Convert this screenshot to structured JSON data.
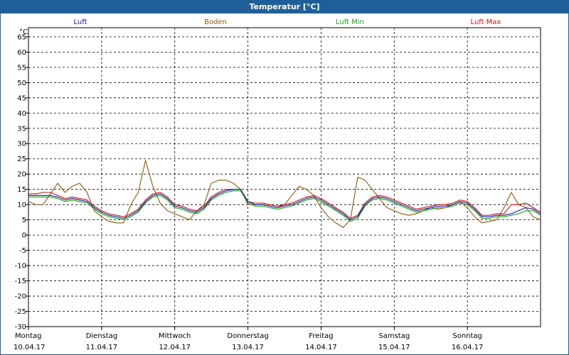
{
  "chart_data": {
    "type": "line",
    "title": "Temperatur [°C]",
    "ylabel": "°C",
    "ylim": [
      -30,
      68
    ],
    "yticks": [
      65,
      60,
      55,
      50,
      45,
      40,
      35,
      30,
      25,
      20,
      15,
      10,
      5,
      0,
      -5,
      -10,
      -15,
      -20,
      -25,
      -30
    ],
    "xlim": [
      0,
      7
    ],
    "grid": true,
    "legend_position": "top",
    "day_labels": [
      {
        "day": "Montag",
        "date": "10.04.17"
      },
      {
        "day": "Dienstag",
        "date": "11.04.17"
      },
      {
        "day": "Mittwoch",
        "date": "12.04.17"
      },
      {
        "day": "Donnerstag",
        "date": "13.04.17"
      },
      {
        "day": "Freitag",
        "date": "14.04.17"
      },
      {
        "day": "Samstag",
        "date": "15.04.17"
      },
      {
        "day": "Sonntag",
        "date": "16.04.17"
      }
    ],
    "series": [
      {
        "name": "Luft",
        "color": "#1a1aa6",
        "x": [
          0,
          0.1,
          0.2,
          0.3,
          0.4,
          0.5,
          0.6,
          0.7,
          0.8,
          0.9,
          1.0,
          1.1,
          1.2,
          1.3,
          1.4,
          1.5,
          1.6,
          1.7,
          1.8,
          1.9,
          2.0,
          2.1,
          2.2,
          2.3,
          2.4,
          2.5,
          2.6,
          2.7,
          2.8,
          2.9,
          3.0,
          3.1,
          3.2,
          3.3,
          3.4,
          3.5,
          3.6,
          3.7,
          3.8,
          3.9,
          4.0,
          4.1,
          4.2,
          4.3,
          4.4,
          4.5,
          4.6,
          4.7,
          4.8,
          4.9,
          5.0,
          5.1,
          5.2,
          5.3,
          5.4,
          5.5,
          5.6,
          5.7,
          5.8,
          5.9,
          6.0,
          6.1,
          6.2,
          6.3,
          6.4,
          6.5,
          6.6,
          6.7,
          6.8,
          6.9,
          7.0
        ],
        "y": [
          13,
          13,
          13,
          13,
          12.5,
          11.5,
          12,
          11.5,
          11,
          9,
          7.5,
          6.5,
          6,
          5.5,
          6.5,
          8,
          11,
          13,
          13.5,
          12,
          9.5,
          9,
          8,
          7.5,
          9,
          12,
          13.5,
          14.5,
          15,
          15,
          11,
          10,
          10,
          9.5,
          9,
          9.5,
          10,
          11,
          12,
          12.5,
          11.5,
          10,
          8.5,
          7,
          5,
          6,
          10,
          12,
          12.5,
          12,
          11,
          10,
          9,
          8,
          8.5,
          9,
          9.5,
          9.5,
          10,
          11,
          10.5,
          8.5,
          6,
          6,
          6.5,
          6.5,
          7,
          8,
          9,
          8.5,
          7
        ]
      },
      {
        "name": "Boden",
        "color": "#8b5a10",
        "x": [
          0,
          0.1,
          0.2,
          0.3,
          0.4,
          0.5,
          0.6,
          0.7,
          0.8,
          0.9,
          1.0,
          1.1,
          1.2,
          1.3,
          1.4,
          1.5,
          1.6,
          1.7,
          1.8,
          1.9,
          2.0,
          2.1,
          2.2,
          2.3,
          2.4,
          2.5,
          2.6,
          2.7,
          2.8,
          2.9,
          3.0,
          3.1,
          3.2,
          3.3,
          3.4,
          3.5,
          3.6,
          3.7,
          3.8,
          3.9,
          4.0,
          4.1,
          4.2,
          4.3,
          4.4,
          4.5,
          4.6,
          4.7,
          4.8,
          4.9,
          5.0,
          5.1,
          5.2,
          5.3,
          5.4,
          5.5,
          5.6,
          5.7,
          5.8,
          5.9,
          6.0,
          6.1,
          6.2,
          6.3,
          6.4,
          6.5,
          6.6,
          6.7,
          6.8,
          6.9,
          7.0
        ],
        "y": [
          11,
          10,
          10,
          13.5,
          17,
          14,
          16,
          17,
          14,
          8,
          6,
          4.5,
          4,
          4,
          10,
          14,
          24.5,
          16,
          10.5,
          8,
          7,
          6,
          5,
          8,
          10,
          17,
          18,
          18,
          17,
          15,
          10,
          10,
          10,
          9.5,
          9,
          10,
          13,
          16,
          15,
          13,
          9,
          6,
          4,
          2.5,
          5,
          19,
          18,
          15,
          12,
          9,
          8,
          7,
          6.5,
          7,
          8,
          9,
          8.5,
          9,
          10,
          11,
          9,
          6,
          4,
          4.5,
          5,
          9,
          14,
          10,
          9,
          6,
          5
        ]
      },
      {
        "name": "Luft Min",
        "color": "#10a810",
        "x": [
          0,
          0.1,
          0.2,
          0.3,
          0.4,
          0.5,
          0.6,
          0.7,
          0.8,
          0.9,
          1.0,
          1.1,
          1.2,
          1.3,
          1.4,
          1.5,
          1.6,
          1.7,
          1.8,
          1.9,
          2.0,
          2.1,
          2.2,
          2.3,
          2.4,
          2.5,
          2.6,
          2.7,
          2.8,
          2.9,
          3.0,
          3.1,
          3.2,
          3.3,
          3.4,
          3.5,
          3.6,
          3.7,
          3.8,
          3.9,
          4.0,
          4.1,
          4.2,
          4.3,
          4.4,
          4.5,
          4.6,
          4.7,
          4.8,
          4.9,
          5.0,
          5.1,
          5.2,
          5.3,
          5.4,
          5.5,
          5.6,
          5.7,
          5.8,
          5.9,
          6.0,
          6.1,
          6.2,
          6.3,
          6.4,
          6.5,
          6.6,
          6.7,
          6.8,
          6.9,
          7.0
        ],
        "y": [
          12.5,
          12.5,
          12.5,
          12.5,
          12,
          11,
          11.5,
          11,
          10.5,
          8.5,
          7,
          6,
          5.5,
          5,
          6,
          7.5,
          10.5,
          12.5,
          13,
          11.5,
          9,
          8.5,
          7.5,
          7,
          8.5,
          11.5,
          13,
          14,
          14.5,
          14.5,
          10.5,
          9.5,
          9.5,
          9,
          8.5,
          9,
          9.5,
          10.5,
          11.5,
          12,
          11,
          9.5,
          8,
          6.5,
          4.5,
          5.5,
          9.5,
          11.5,
          12,
          11.5,
          10.5,
          9.5,
          8.5,
          7.5,
          8,
          8.5,
          9,
          9,
          9.5,
          10.5,
          10,
          8,
          5.5,
          5.5,
          6,
          6,
          6.5,
          7,
          8,
          8,
          6.5
        ]
      },
      {
        "name": "Luft Max",
        "color": "#c81414",
        "x": [
          0,
          0.1,
          0.2,
          0.3,
          0.4,
          0.5,
          0.6,
          0.7,
          0.8,
          0.9,
          1.0,
          1.1,
          1.2,
          1.3,
          1.4,
          1.5,
          1.6,
          1.7,
          1.8,
          1.9,
          2.0,
          2.1,
          2.2,
          2.3,
          2.4,
          2.5,
          2.6,
          2.7,
          2.8,
          2.9,
          3.0,
          3.1,
          3.2,
          3.3,
          3.4,
          3.5,
          3.6,
          3.7,
          3.8,
          3.9,
          4.0,
          4.1,
          4.2,
          4.3,
          4.4,
          4.5,
          4.6,
          4.7,
          4.8,
          4.9,
          5.0,
          5.1,
          5.2,
          5.3,
          5.4,
          5.5,
          5.6,
          5.7,
          5.8,
          5.9,
          6.0,
          6.1,
          6.2,
          6.3,
          6.4,
          6.5,
          6.6,
          6.7,
          6.8,
          6.9,
          7.0
        ],
        "y": [
          13.5,
          13.5,
          14,
          14,
          13,
          12,
          12.5,
          12,
          11.5,
          9.5,
          8,
          7,
          6.5,
          6,
          7,
          8.5,
          11.5,
          13.5,
          14,
          12.5,
          10,
          9.5,
          8.5,
          8,
          9.5,
          12.5,
          14,
          15,
          15,
          15,
          11,
          10.5,
          10.5,
          10,
          9.5,
          10,
          10.5,
          11.5,
          12.5,
          13,
          12,
          10.5,
          9,
          7.5,
          5.5,
          6.5,
          10.5,
          12.5,
          13,
          12.5,
          11.5,
          10.5,
          9.5,
          8.5,
          9,
          9.5,
          10,
          10,
          10.5,
          11.5,
          11,
          9,
          6.5,
          6.5,
          7,
          7,
          10,
          10,
          10.5,
          9,
          7.5
        ]
      }
    ]
  }
}
